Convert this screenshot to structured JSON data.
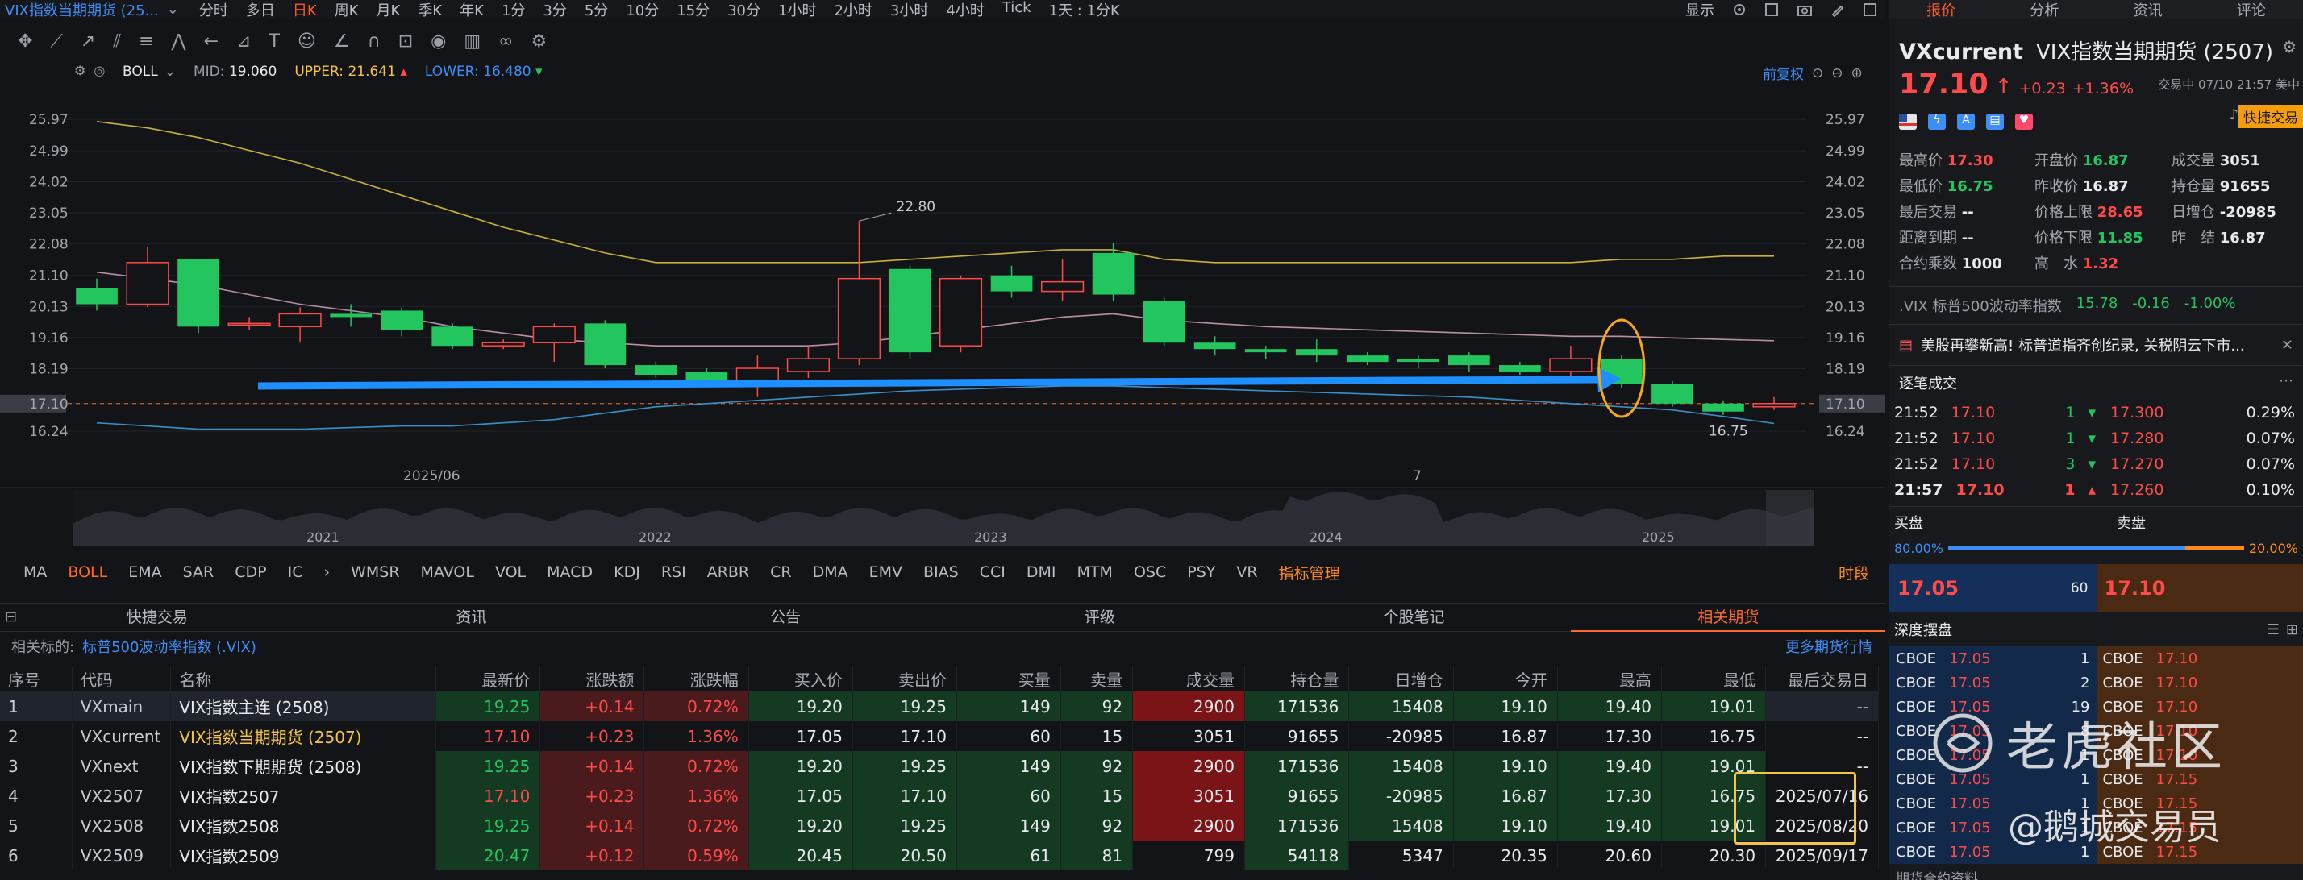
{
  "window": {
    "title": "VIX指数当期期货 (25...",
    "chevron": "⌄"
  },
  "periods": [
    "分时",
    "多日",
    "日K",
    "周K",
    "月K",
    "季K",
    "年K",
    "1分",
    "3分",
    "5分",
    "10分",
    "15分",
    "30分",
    "1小时",
    "2小时",
    "3小时",
    "4小时",
    "Tick",
    "1天 : 1分K"
  ],
  "active_period": "日K",
  "display_label": "显示",
  "indicator": {
    "name": "BOLL",
    "mid_label": "MID:",
    "mid": "19.060",
    "upper_label": "UPPER:",
    "upper": "21.641",
    "lower_label": "LOWER:",
    "lower": "16.480",
    "restore": "前复权"
  },
  "chart_data": {
    "type": "candlestick",
    "y_ticks": [
      "25.97",
      "24.99",
      "24.02",
      "23.05",
      "22.08",
      "21.10",
      "20.13",
      "19.16",
      "18.19",
      "17.10",
      "16.24"
    ],
    "x_ticks": [
      "2025/06",
      "7"
    ],
    "current_price": "17.10",
    "annotations": {
      "high": "22.80",
      "low": "16.75"
    },
    "candles": [
      {
        "o": 20.7,
        "c": 20.2,
        "h": 21.0,
        "l": 20.0
      },
      {
        "o": 20.2,
        "c": 21.5,
        "h": 22.0,
        "l": 20.1
      },
      {
        "o": 21.6,
        "c": 19.5,
        "h": 21.6,
        "l": 19.3
      },
      {
        "o": 19.6,
        "c": 19.6,
        "h": 19.8,
        "l": 19.4
      },
      {
        "o": 19.5,
        "c": 19.9,
        "h": 20.1,
        "l": 19.0
      },
      {
        "o": 19.9,
        "c": 19.8,
        "h": 20.2,
        "l": 19.5
      },
      {
        "o": 20.0,
        "c": 19.4,
        "h": 20.1,
        "l": 19.2
      },
      {
        "o": 19.5,
        "c": 18.9,
        "h": 19.6,
        "l": 18.8
      },
      {
        "o": 18.9,
        "c": 19.0,
        "h": 19.1,
        "l": 18.8
      },
      {
        "o": 19.0,
        "c": 19.5,
        "h": 19.6,
        "l": 18.4
      },
      {
        "o": 19.6,
        "c": 18.3,
        "h": 19.7,
        "l": 18.2
      },
      {
        "o": 18.3,
        "c": 18.0,
        "h": 18.4,
        "l": 17.9
      },
      {
        "o": 18.1,
        "c": 17.8,
        "h": 18.2,
        "l": 17.7
      },
      {
        "o": 17.8,
        "c": 18.2,
        "h": 18.6,
        "l": 17.3
      },
      {
        "o": 18.1,
        "c": 18.5,
        "h": 18.9,
        "l": 17.9
      },
      {
        "o": 18.5,
        "c": 21.0,
        "h": 22.8,
        "l": 18.3
      },
      {
        "o": 21.3,
        "c": 18.7,
        "h": 21.4,
        "l": 18.5
      },
      {
        "o": 18.9,
        "c": 21.0,
        "h": 21.1,
        "l": 18.7
      },
      {
        "o": 21.1,
        "c": 20.6,
        "h": 21.4,
        "l": 20.4
      },
      {
        "o": 20.6,
        "c": 20.9,
        "h": 21.6,
        "l": 20.3
      },
      {
        "o": 21.8,
        "c": 20.5,
        "h": 22.1,
        "l": 20.3
      },
      {
        "o": 20.3,
        "c": 19.0,
        "h": 20.4,
        "l": 18.9
      },
      {
        "o": 19.0,
        "c": 18.8,
        "h": 19.2,
        "l": 18.6
      },
      {
        "o": 18.8,
        "c": 18.7,
        "h": 18.9,
        "l": 18.5
      },
      {
        "o": 18.8,
        "c": 18.6,
        "h": 19.1,
        "l": 18.4
      },
      {
        "o": 18.6,
        "c": 18.4,
        "h": 18.7,
        "l": 18.3
      },
      {
        "o": 18.5,
        "c": 18.4,
        "h": 18.6,
        "l": 18.2
      },
      {
        "o": 18.6,
        "c": 18.3,
        "h": 18.7,
        "l": 18.1
      },
      {
        "o": 18.3,
        "c": 18.1,
        "h": 18.4,
        "l": 18.0
      },
      {
        "o": 18.1,
        "c": 18.5,
        "h": 18.9,
        "l": 17.9
      },
      {
        "o": 18.5,
        "c": 17.7,
        "h": 18.6,
        "l": 17.6
      },
      {
        "o": 17.7,
        "c": 17.1,
        "h": 17.8,
        "l": 17.0
      },
      {
        "o": 17.1,
        "c": 16.85,
        "h": 17.2,
        "l": 16.75
      },
      {
        "o": 17.0,
        "c": 17.1,
        "h": 17.3,
        "l": 16.9
      }
    ],
    "boll_upper": [
      25.9,
      25.7,
      25.4,
      25.0,
      24.6,
      24.1,
      23.6,
      23.1,
      22.6,
      22.2,
      21.8,
      21.5,
      21.5,
      21.5,
      21.5,
      21.5,
      21.6,
      21.7,
      21.8,
      21.9,
      21.9,
      21.6,
      21.5,
      21.5,
      21.5,
      21.5,
      21.5,
      21.5,
      21.5,
      21.5,
      21.6,
      21.6,
      21.7,
      21.7
    ],
    "boll_mid": [
      21.2,
      21.0,
      20.8,
      20.5,
      20.2,
      20.0,
      19.8,
      19.5,
      19.3,
      19.1,
      19.0,
      18.9,
      18.9,
      18.9,
      18.9,
      19.0,
      19.2,
      19.4,
      19.6,
      19.8,
      19.9,
      19.7,
      19.6,
      19.5,
      19.45,
      19.4,
      19.35,
      19.3,
      19.25,
      19.2,
      19.2,
      19.15,
      19.1,
      19.06
    ],
    "boll_lower": [
      16.5,
      16.4,
      16.3,
      16.3,
      16.3,
      16.35,
      16.4,
      16.4,
      16.5,
      16.6,
      16.8,
      17.0,
      17.1,
      17.2,
      17.3,
      17.4,
      17.5,
      17.55,
      17.6,
      17.65,
      17.65,
      17.6,
      17.55,
      17.5,
      17.45,
      17.4,
      17.35,
      17.3,
      17.2,
      17.1,
      17.0,
      16.9,
      16.7,
      16.48
    ],
    "overview_years": [
      "2021",
      "2022",
      "2023",
      "2024",
      "2025"
    ]
  },
  "indicators_bar": [
    "MA",
    "BOLL",
    "EMA",
    "SAR",
    "CDP",
    "IC",
    "WMSR",
    "MAVOL",
    "VOL",
    "MACD",
    "KDJ",
    "RSI",
    "ARBR",
    "CR",
    "DMA",
    "EMV",
    "BIAS",
    "CCI",
    "DMI",
    "MTM",
    "OSC",
    "PSY",
    "VR"
  ],
  "indicators_manage": "指标管理",
  "time_label": "时段",
  "bottom_tabs": [
    "快捷交易",
    "资讯",
    "公告",
    "评级",
    "个股笔记",
    "相关期货"
  ],
  "related": {
    "label": "相关标的:",
    "value": "标普500波动率指数 (.VIX)",
    "more": "更多期货行情"
  },
  "table": {
    "headers": [
      "序号",
      "代码",
      "名称",
      "最新价",
      "涨跌额",
      "涨跌幅",
      "买入价",
      "卖出价",
      "买量",
      "卖量",
      "成交量",
      "持仓量",
      "日增仓",
      "今开",
      "最高",
      "最低",
      "最后交易日"
    ],
    "rows": [
      [
        "1",
        "VXmain",
        "VIX指数主连 (2508)",
        "19.25",
        "+0.14",
        "0.72%",
        "19.20",
        "19.25",
        "149",
        "92",
        "2900",
        "171536",
        "15408",
        "19.10",
        "19.40",
        "19.01",
        "--"
      ],
      [
        "2",
        "VXcurrent",
        "VIX指数当期期货 (2507)",
        "17.10",
        "+0.23",
        "1.36%",
        "17.05",
        "17.10",
        "60",
        "15",
        "3051",
        "91655",
        "-20985",
        "16.87",
        "17.30",
        "16.75",
        "--"
      ],
      [
        "3",
        "VXnext",
        "VIX指数下期期货 (2508)",
        "19.25",
        "+0.14",
        "0.72%",
        "19.20",
        "19.25",
        "149",
        "92",
        "2900",
        "171536",
        "15408",
        "19.10",
        "19.40",
        "19.01",
        "--"
      ],
      [
        "4",
        "VX2507",
        "VIX指数2507",
        "17.10",
        "+0.23",
        "1.36%",
        "17.05",
        "17.10",
        "60",
        "15",
        "3051",
        "91655",
        "-20985",
        "16.87",
        "17.30",
        "16.75",
        "2025/07/16"
      ],
      [
        "5",
        "VX2508",
        "VIX指数2508",
        "19.25",
        "+0.14",
        "0.72%",
        "19.20",
        "19.25",
        "149",
        "92",
        "2900",
        "171536",
        "15408",
        "19.10",
        "19.40",
        "19.01",
        "2025/08/20"
      ],
      [
        "6",
        "VX2509",
        "VIX指数2509",
        "20.47",
        "+0.12",
        "0.59%",
        "20.45",
        "20.50",
        "61",
        "81",
        "799",
        "54118",
        "5347",
        "20.35",
        "20.60",
        "20.30",
        "2025/09/17"
      ]
    ]
  },
  "right": {
    "tabs": [
      "报价",
      "分析",
      "资讯",
      "评论"
    ],
    "symbol": "VXcurrent",
    "name": "VIX指数当期期货 (2507)",
    "price": "17.10",
    "arrow": "↑",
    "change": "+0.23",
    "pct": "+1.36%",
    "status": "交易中 07/10 21:57 美中",
    "quick_trade": "快捷交易",
    "stats": [
      [
        "最高价",
        "17.30",
        "开盘价",
        "16.87",
        "成交量",
        "3051"
      ],
      [
        "最低价",
        "16.75",
        "昨收价",
        "16.87",
        "持仓量",
        "91655"
      ],
      [
        "最后交易",
        "--",
        "价格上限",
        "28.65",
        "日增仓",
        "-20985"
      ],
      [
        "距离到期",
        "--",
        "价格下限",
        "11.85",
        "昨　结",
        "16.87"
      ],
      [
        "合约乘数",
        "1000",
        "高　水",
        "1.32",
        "",
        ""
      ]
    ],
    "vix_line": {
      "name": ".VIX 标普500波动率指数",
      "price": "15.78",
      "chg": "-0.16",
      "pct": "-1.00%"
    },
    "news": "美股再攀新高! 标普道指齐创纪录, 关税阴云下市...",
    "ticks_title": "逐笔成交",
    "ticks": [
      [
        "21:52",
        "17.10",
        "1"
      ],
      [
        "21:52",
        "17.10",
        "1"
      ],
      [
        "21:52",
        "17.10",
        "3"
      ],
      [
        "21:57",
        "17.10",
        "1"
      ]
    ],
    "asks": [
      [
        "17.300",
        "0.29%"
      ],
      [
        "17.280",
        "0.07%"
      ],
      [
        "17.270",
        "0.07%"
      ],
      [
        "17.260",
        "0.10%"
      ]
    ],
    "buy_label": "买盘",
    "sell_label": "卖盘",
    "buy_pct": "80.00%",
    "sell_pct": "20.00%",
    "bid": "17.05",
    "bid_qty": "60",
    "ask": "17.10",
    "depth_title": "深度摆盘",
    "depth_bids": [
      [
        "CBOE",
        "17.05",
        "1"
      ],
      [
        "CBOE",
        "17.05",
        "2"
      ],
      [
        "CBOE",
        "17.05",
        "19"
      ],
      [
        "CBOE",
        "17.05",
        "8"
      ],
      [
        "CBOE",
        "17.05",
        "1"
      ],
      [
        "CBOE",
        "17.05",
        "1"
      ],
      [
        "CBOE",
        "17.05",
        "1"
      ],
      [
        "CBOE",
        "17.05",
        "1"
      ],
      [
        "CBOE",
        "17.05",
        "1"
      ]
    ],
    "depth_asks": [
      [
        "CBOE",
        "17.10"
      ],
      [
        "CBOE",
        "17.10"
      ],
      [
        "CBOE",
        "17.10"
      ],
      [
        "CBOE",
        "17.10"
      ],
      [
        "CBOE",
        "17.10"
      ],
      [
        "CBOE",
        "17.15"
      ],
      [
        "CBOE",
        "17.15"
      ],
      [
        "CBOE",
        "17.15"
      ],
      [
        "CBOE",
        "17.15"
      ]
    ],
    "footer": "期货合约资料"
  },
  "watermark": {
    "brand": "老虎社区",
    "author": "@鹅城交易员"
  },
  "colors": {
    "up": "#ff4a4a",
    "down": "#22c55e",
    "accent": "#ff6a2a",
    "link": "#3d8ef7",
    "highlight": "#f4c542"
  }
}
